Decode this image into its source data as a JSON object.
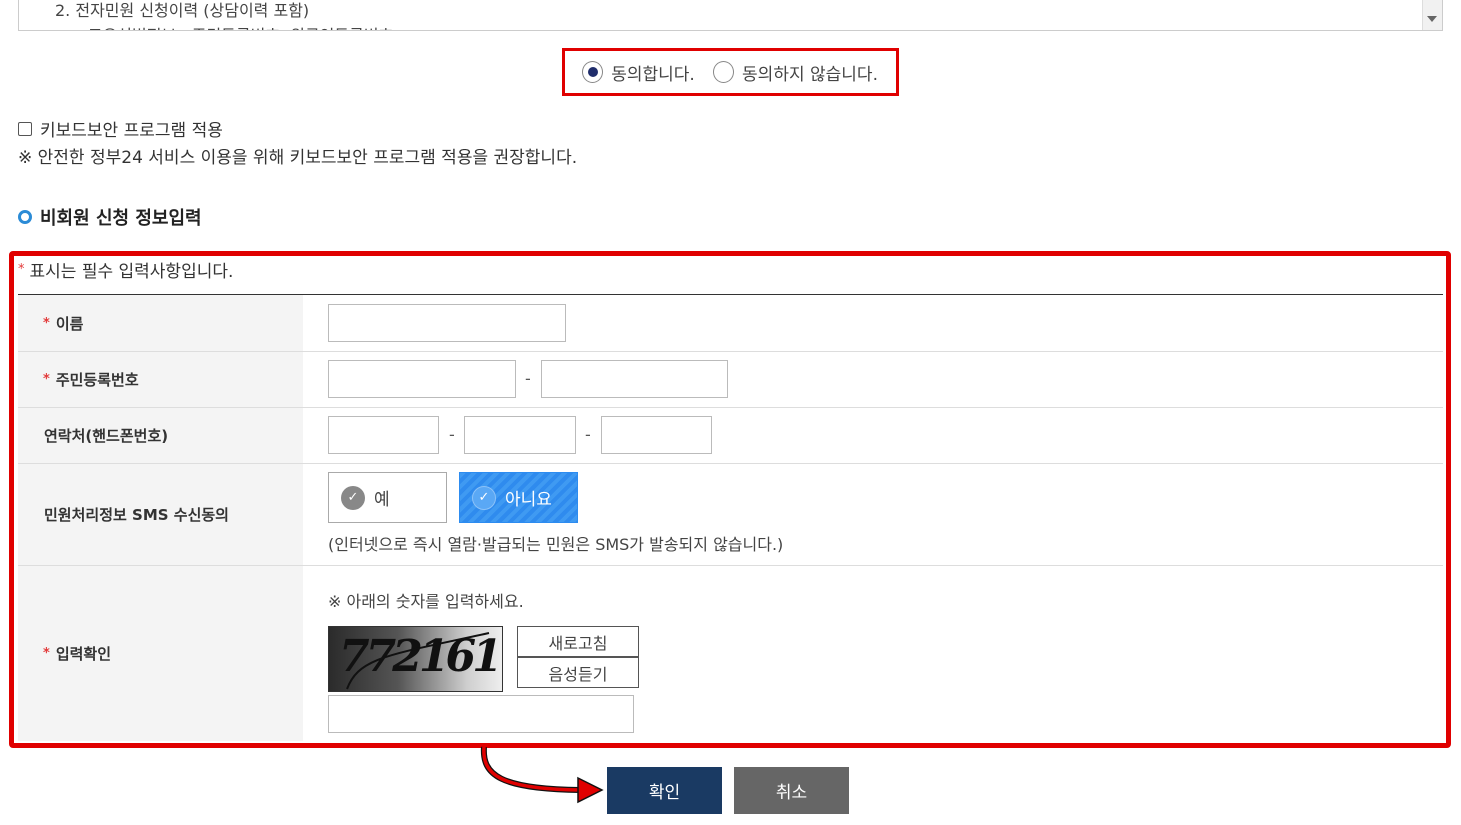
{
  "terms": {
    "line1": "2. 전자민원 신청이력 (상담이력 포함)",
    "line2": "- 고유식별정보 : 주민등록번호, 외국인등록번호"
  },
  "consent": {
    "agree_label": "동의합니다.",
    "disagree_label": "동의하지 않습니다.",
    "selected": "agree"
  },
  "keyboard_security": {
    "label": "키보드보안 프로그램 적용",
    "checked": false,
    "note": "※ 안전한 정부24 서비스 이용을 위해 키보드보안 프로그램 적용을 권장합니다."
  },
  "section": {
    "title": "비회원 신청 정보입력"
  },
  "form": {
    "required_note": "표시는 필수 입력사항입니다.",
    "required_mark": "*",
    "name_label": "이름",
    "rrn_label": "주민등록번호",
    "rrn_dash": "-",
    "phone_label": "연락처(핸드폰번호)",
    "phone_dash": "-",
    "sms_label": "민원처리정보 SMS 수신동의",
    "sms_yes": "예",
    "sms_no": "아니요",
    "sms_selected": "아니요",
    "sms_note": "(인터넷으로 즉시 열람·발급되는 민원은 SMS가 발송되지 않습니다.)",
    "captcha_label": "입력확인",
    "captcha_guide": "※ 아래의 숫자를 입력하세요.",
    "captcha_code": "772161",
    "refresh_label": "새로고침",
    "audio_label": "음성듣기"
  },
  "buttons": {
    "confirm": "확인",
    "cancel": "취소"
  },
  "colors": {
    "highlight": "#e00000",
    "confirm_bg": "#1a3a63",
    "cancel_bg": "#666666",
    "sms_selected_bg": "#3f9af2"
  }
}
